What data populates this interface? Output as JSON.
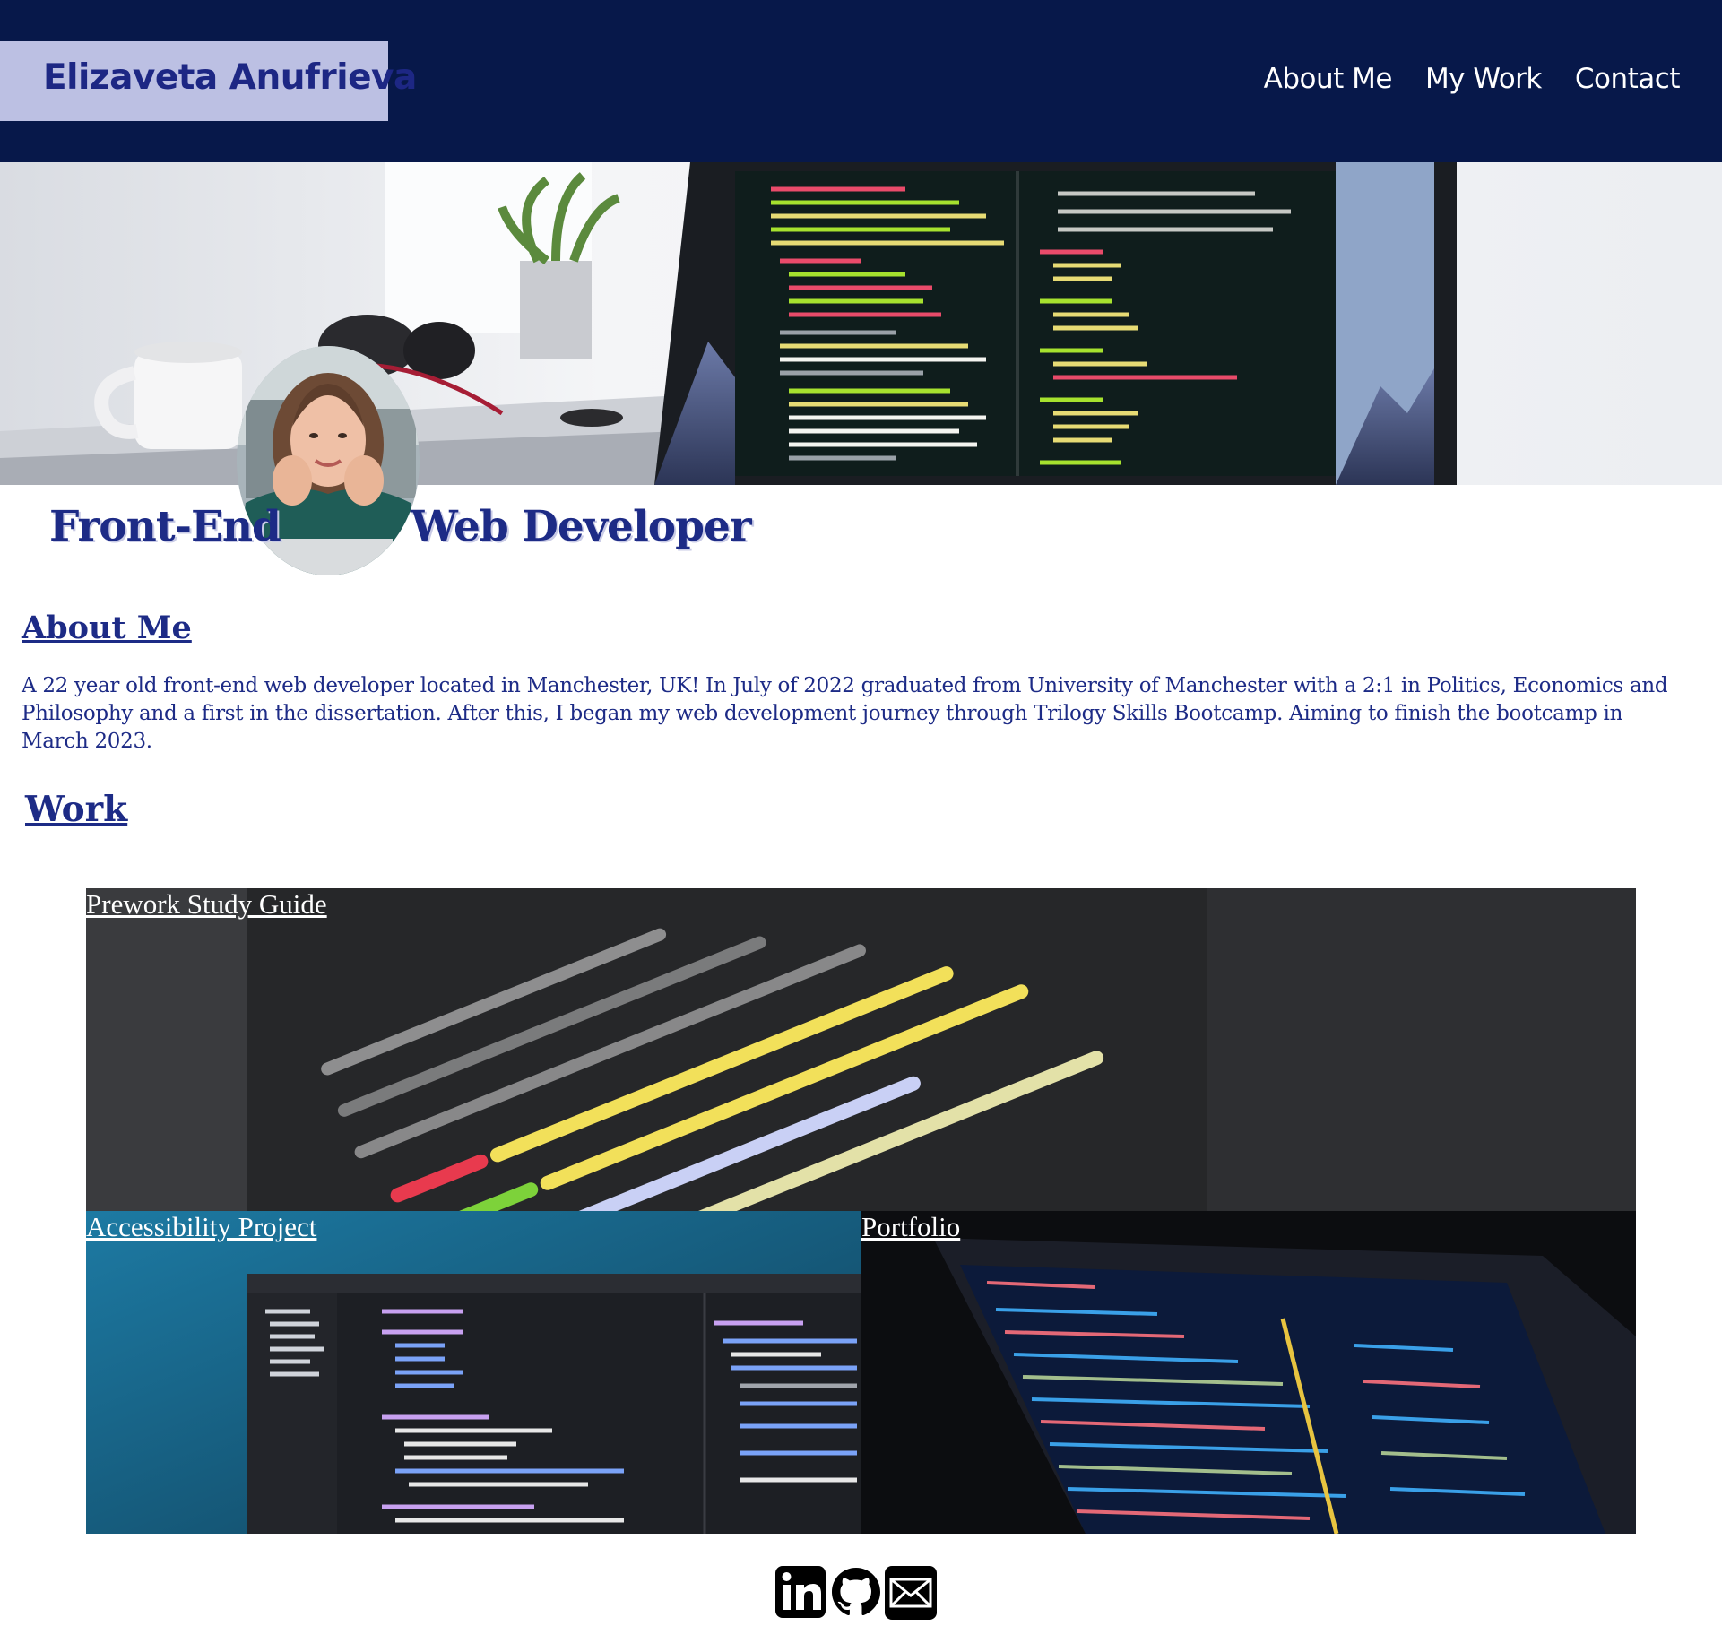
{
  "header": {
    "brand": "Elizaveta Anufrieva",
    "nav": [
      "About Me",
      "My Work",
      "Contact"
    ]
  },
  "headline": {
    "left": "Front-End",
    "right": "Web Developer"
  },
  "about": {
    "title": "About Me",
    "text": "A 22 year old front-end web developer located in Manchester, UK! In July of 2022 graduated from University of Manchester with a 2:1 in Politics, Economics and Philosophy and a first in the dissertation. After this, I began my web development journey through Trilogy Skills Bootcamp. Aiming to finish the bootcamp in March 2023."
  },
  "work": {
    "title": "Work",
    "projects": [
      {
        "label": "Prework Study Guide"
      },
      {
        "label": "Accessibility Project"
      },
      {
        "label": "Portfolio"
      }
    ]
  },
  "social": {
    "icons": [
      "linkedin-icon",
      "github-icon",
      "email-icon"
    ]
  },
  "colors": {
    "header_bg": "#07184a",
    "brand_bg": "#bcc0e3",
    "accent_text": "#1d2b86"
  }
}
